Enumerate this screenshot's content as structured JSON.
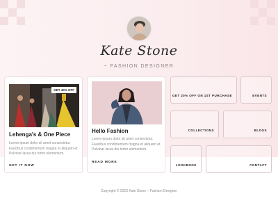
{
  "brand": {
    "name": "Kate Stone",
    "subtitle": "~ FASHION DESIGNER"
  },
  "cards": [
    {
      "badge": "GET 40% OFF",
      "title": "Lehenga's & One Piece",
      "text": "Lorem ipsum dolor sit amet consectetur. Faucibus condimentum magna et aliquam et. Pulvinar lacus dui tortor elementum.",
      "link": "GET IT NOW"
    },
    {
      "title": "Hello Fashion",
      "text": "Lorem ipsum dolor sit amet consectetur. Faucibus condimentum magna et aliquam et. Pulvinar lacus dui tortor elementum.",
      "link": "READ MORE"
    }
  ],
  "tiles": {
    "offer": "GET 20% OFF ON 1ST PURCHASE",
    "events": "EVENTS",
    "collections": "COLLECTIONS",
    "blogs": "BLOGS",
    "lookbook": "LOOKBOOK",
    "contact": "CONTACT"
  },
  "footer": {
    "copyright": "Copyright © 2023 Kate Stone ~ Fashion Designer"
  },
  "colors": {
    "background_tint": "#fbeef0",
    "border": "#d9c8cc",
    "text_dark": "#1a1a1a",
    "text_muted": "#8b8b8b"
  }
}
